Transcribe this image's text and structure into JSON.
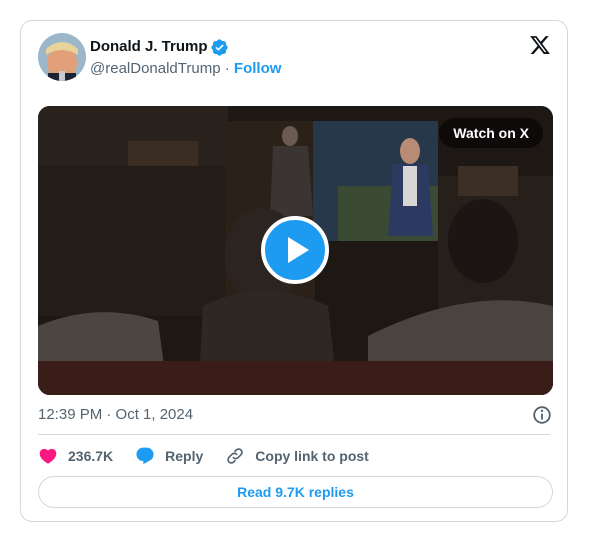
{
  "author": {
    "name": "Donald J. Trump",
    "handle": "@realDonaldTrump",
    "separator": "·",
    "follow_label": "Follow"
  },
  "media": {
    "watch_label": "Watch on X"
  },
  "meta": {
    "timestamp": "12:39 PM · Oct 1, 2024"
  },
  "actions": {
    "likes": "236.7K",
    "reply_label": "Reply",
    "copy_label": "Copy link to post"
  },
  "read_replies_label": "Read 9.7K replies",
  "colors": {
    "accent": "#1d9bf0",
    "like": "#f91880",
    "muted": "#536471",
    "border": "#cfd9de"
  },
  "icons": [
    "verified-badge-icon",
    "x-logo-icon",
    "play-icon",
    "info-icon",
    "heart-icon",
    "reply-icon",
    "link-icon"
  ]
}
